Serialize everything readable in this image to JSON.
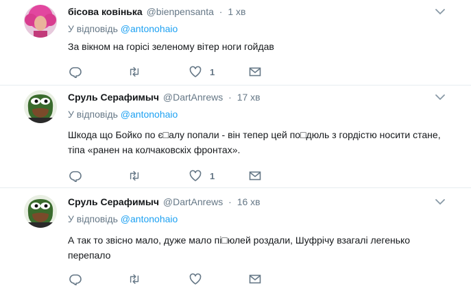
{
  "tweets": [
    {
      "name": "бісова ковінька",
      "handle": "@bienpensanta",
      "time": "1 хв",
      "reply_prefix": "У відповідь",
      "reply_to": "@antonohaio",
      "text": "За вікном на горісі зеленому вітер ноги гойдав",
      "like_count": "1",
      "avatar": "pink-haired-avatar"
    },
    {
      "name": "Сруль Серафимыч",
      "handle": "@DartAnrews",
      "time": "17 хв",
      "reply_prefix": "У відповідь",
      "reply_to": "@antonohaio",
      "text": "Шкода що Бойко по є□алу попали - він тепер цей по□дюль з гордістю носити стане, тіпа «ранен на колчаковскіх фронтах».",
      "like_count": "1",
      "avatar": "frog-avatar"
    },
    {
      "name": "Сруль Серафимыч",
      "handle": "@DartAnrews",
      "time": "16 хв",
      "reply_prefix": "У відповідь",
      "reply_to": "@antonohaio",
      "text": "А так то звісно мало, дуже мало пі□юлей роздали, Шуфрічу взагалі легенько перепало",
      "like_count": "",
      "avatar": "frog-avatar"
    }
  ],
  "colors": {
    "link": "#1da1f2",
    "secondary": "#657786",
    "text": "#14171a",
    "border": "#e6ecf0"
  }
}
